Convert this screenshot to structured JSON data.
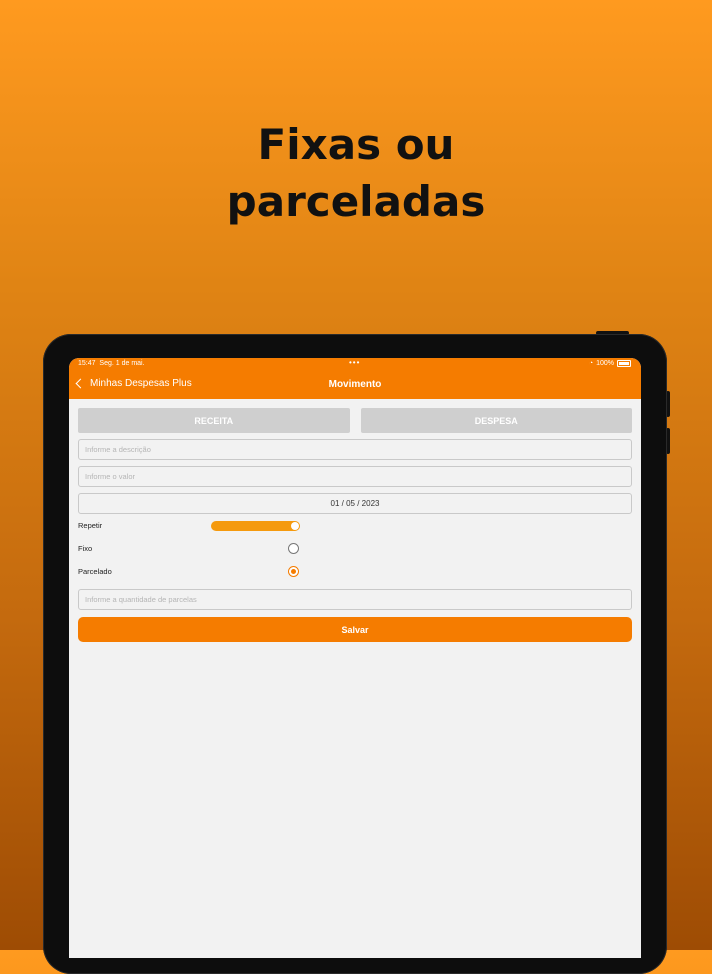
{
  "promo": {
    "line1": "Fixas ou",
    "line2": "parceladas"
  },
  "statusbar": {
    "time": "15:47",
    "date": "Seg. 1 de mai.",
    "dots": "•••",
    "battery_pct": "100%"
  },
  "navbar": {
    "back_label": "Minhas Despesas Plus",
    "title": "Movimento"
  },
  "form": {
    "receita_label": "RECEITA",
    "despesa_label": "DESPESA",
    "description_placeholder": "Informe a descrição",
    "value_placeholder": "Informe o valor",
    "date_value": "01 / 05 / 2023",
    "repetir_label": "Repetir",
    "repetir_on": true,
    "fixo_label": "Fixo",
    "fixo_selected": false,
    "parcelado_label": "Parcelado",
    "parcelado_selected": true,
    "parcelas_placeholder": "Informe a quantidade de parcelas",
    "save_label": "Salvar"
  },
  "colors": {
    "accent": "#f57c00",
    "toggle": "#f59a0e",
    "type_button": "#cfcfcf",
    "background": "#f2f2f2"
  }
}
